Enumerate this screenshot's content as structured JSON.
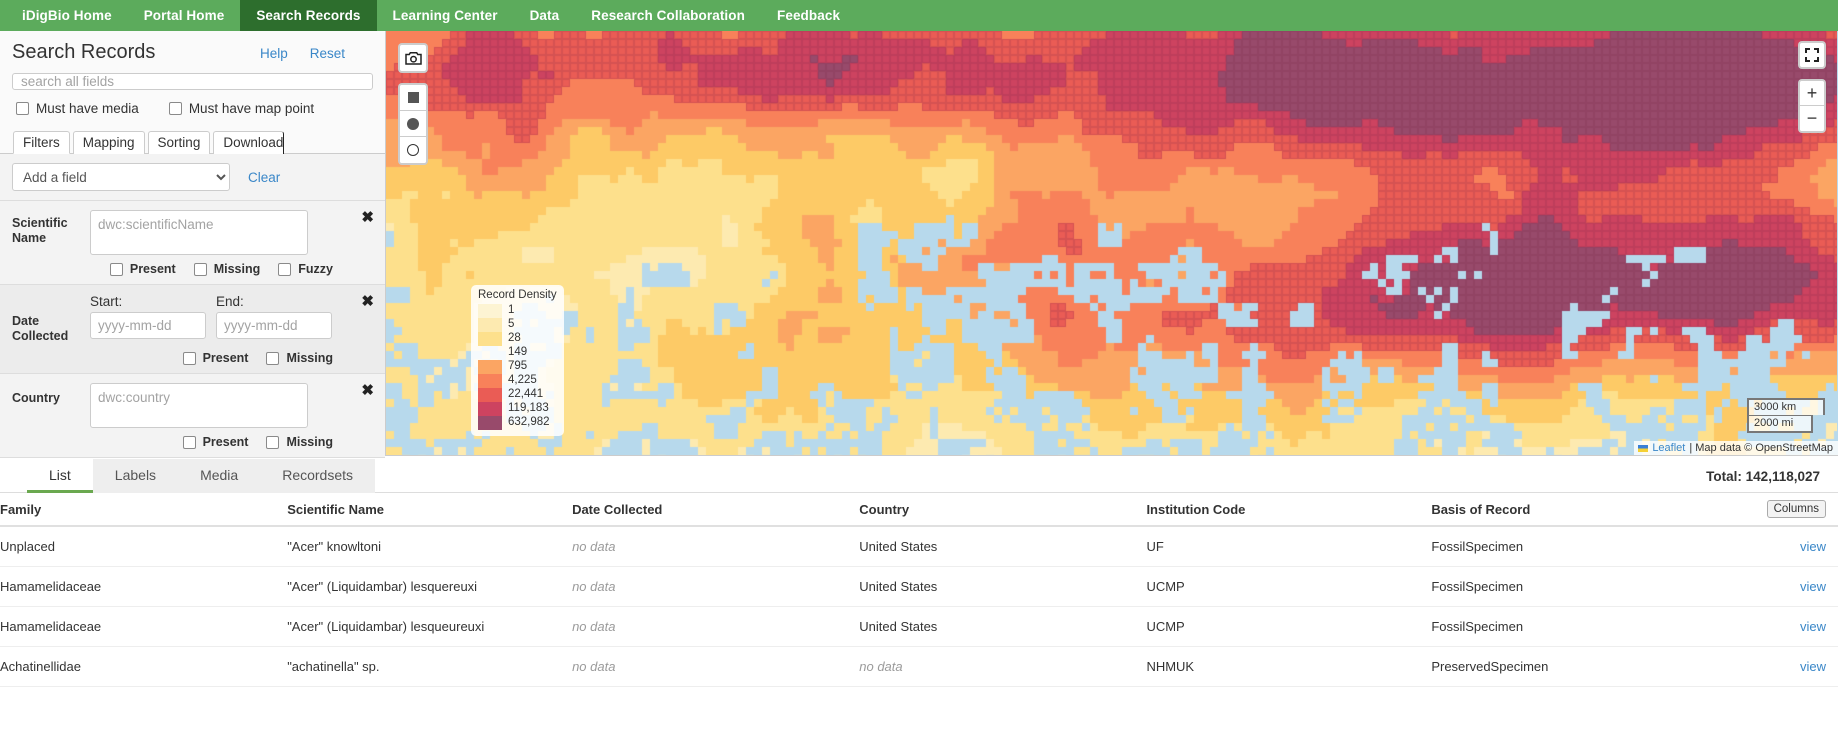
{
  "nav": {
    "items": [
      {
        "label": "iDigBio Home",
        "active": false
      },
      {
        "label": "Portal Home",
        "active": false
      },
      {
        "label": "Search Records",
        "active": true
      },
      {
        "label": "Learning Center",
        "active": false
      },
      {
        "label": "Data",
        "active": false
      },
      {
        "label": "Research Collaboration",
        "active": false
      },
      {
        "label": "Feedback",
        "active": false
      }
    ]
  },
  "sidebar": {
    "title": "Search Records",
    "help_label": "Help",
    "reset_label": "Reset",
    "search_placeholder": "search all fields",
    "search_value": "",
    "checkboxes": [
      {
        "label": "Must have media",
        "checked": false
      },
      {
        "label": "Must have map point",
        "checked": false
      }
    ],
    "tabs": [
      {
        "label": "Filters",
        "active": true
      },
      {
        "label": "Mapping",
        "active": false
      },
      {
        "label": "Sorting",
        "active": false
      },
      {
        "label": "Download",
        "active": false
      }
    ],
    "add_field_value": "Add a field",
    "clear_label": "Clear",
    "filters": [
      {
        "label": "Scientific Name",
        "placeholder": "dwc:scientificName",
        "value": "",
        "options": [
          "Present",
          "Missing",
          "Fuzzy"
        ],
        "remove_label": "✖"
      },
      {
        "label": "Date Collected",
        "start_label": "Start:",
        "end_label": "End:",
        "start_placeholder": "yyyy-mm-dd",
        "end_placeholder": "yyyy-mm-dd",
        "start_value": "",
        "end_value": "",
        "options": [
          "Present",
          "Missing"
        ],
        "remove_label": "✖"
      },
      {
        "label": "Country",
        "placeholder": "dwc:country",
        "value": "",
        "options": [
          "Present",
          "Missing"
        ],
        "remove_label": "✖"
      }
    ]
  },
  "map": {
    "camera_icon": "camera-icon",
    "shape_icons": [
      "filled-square-icon",
      "filled-circle-icon",
      "hollow-circle-icon"
    ],
    "fullscreen_icon": "fullscreen-icon",
    "zoom_in_label": "+",
    "zoom_out_label": "−",
    "legend": {
      "title": "Record Density",
      "entries": [
        {
          "value": "1",
          "color": "#fdf4d3"
        },
        {
          "value": "5",
          "color": "#fdeab0"
        },
        {
          "value": "28",
          "color": "#fde08c"
        },
        {
          "value": "149",
          "color": "#fdc濃a66"
        },
        {
          "value": "795",
          "color": "#fba563"
        },
        {
          "value": "4,225",
          "color": "#f8815a"
        },
        {
          "value": "22,441",
          "color": "#ea5c55"
        },
        {
          "value": "119,183",
          "color": "#cd4360"
        },
        {
          "value": "632,982",
          "color": "#984a6b"
        }
      ]
    },
    "scale_km": "3000 km",
    "scale_mi": "2000 mi",
    "attribution_link": "Leaflet",
    "attribution_text": "| Map data © OpenStreetMap"
  },
  "results": {
    "tabs": [
      {
        "label": "List",
        "active": true
      },
      {
        "label": "Labels",
        "active": false
      },
      {
        "label": "Media",
        "active": false
      },
      {
        "label": "Recordsets",
        "active": false
      }
    ],
    "total_label": "Total: 142,118,027",
    "columns_button": "Columns",
    "headers": [
      "Family",
      "Scientific Name",
      "Date Collected",
      "Country",
      "Institution Code",
      "Basis of Record"
    ],
    "rows": [
      {
        "family": "Unplaced",
        "scientific_name": "\"Acer\" knowltoni",
        "date_collected": "no data",
        "date_collected_empty": true,
        "country": "United States",
        "country_empty": false,
        "institution_code": "UF",
        "basis_of_record": "FossilSpecimen",
        "view": "view"
      },
      {
        "family": "Hamamelidaceae",
        "scientific_name": "\"Acer\" (Liquidambar) lesquereuxi",
        "date_collected": "no data",
        "date_collected_empty": true,
        "country": "United States",
        "country_empty": false,
        "institution_code": "UCMP",
        "basis_of_record": "FossilSpecimen",
        "view": "view"
      },
      {
        "family": "Hamamelidaceae",
        "scientific_name": "\"Acer\" (Liquidambar) lesqueureuxi",
        "date_collected": "no data",
        "date_collected_empty": true,
        "country": "United States",
        "country_empty": false,
        "institution_code": "UCMP",
        "basis_of_record": "FossilSpecimen",
        "view": "view"
      },
      {
        "family": "Achatinellidae",
        "scientific_name": "\"achatinella\" sp.",
        "date_collected": "no data",
        "date_collected_empty": true,
        "country": "no data",
        "country_empty": true,
        "institution_code": "NHMUK",
        "basis_of_record": "PreservedSpecimen",
        "view": "view"
      }
    ]
  }
}
